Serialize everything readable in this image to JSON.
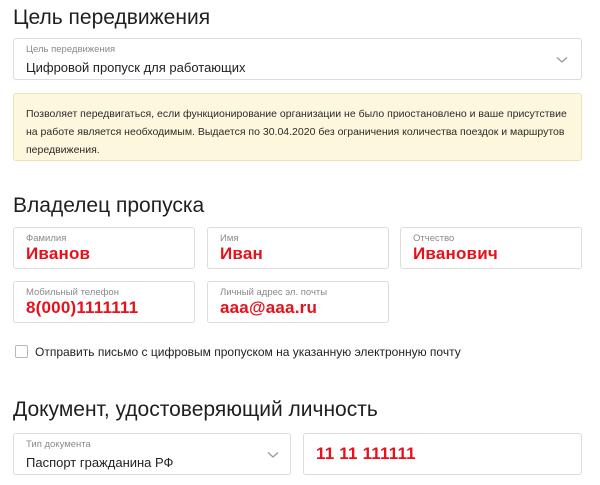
{
  "sections": {
    "purpose_title": "Цель передвижения",
    "owner_title": "Владелец пропуска",
    "document_title": "Документ, удостоверяющий личность"
  },
  "purpose_select": {
    "label": "Цель передвижения",
    "value": "Цифровой пропуск для работающих"
  },
  "notice": {
    "text": "Позволяет передвигаться, если функционирование организации не было приостановлено и ваше присутствие на работе является необходимым. Выдается по 30.04.2020 без ограничения количества поездок и маршрутов передвижения."
  },
  "owner": {
    "surname": {
      "label": "Фамилия",
      "value": "Иванов"
    },
    "name": {
      "label": "Имя",
      "value": "Иван"
    },
    "patronymic": {
      "label": "Отчество",
      "value": "Иванович"
    },
    "phone": {
      "label": "Мобильный телефон",
      "value": "8(000)1111111"
    },
    "email": {
      "label": "Личный адрес эл. почты",
      "value": "aaa@aaa.ru"
    }
  },
  "send_email_checkbox": {
    "label": "Отправить письмо с цифровым пропуском на указанную электронную почту",
    "checked": false
  },
  "document": {
    "type": {
      "label": "Тип документа",
      "value": "Паспорт гражданина РФ"
    },
    "number": {
      "value": "11 11 111111"
    }
  },
  "colors": {
    "accent_red": "#e8101a",
    "notice_bg": "#fdf7dd",
    "border": "#dcdcdc"
  },
  "icons": {
    "dropdown": "chevron-down-icon"
  }
}
